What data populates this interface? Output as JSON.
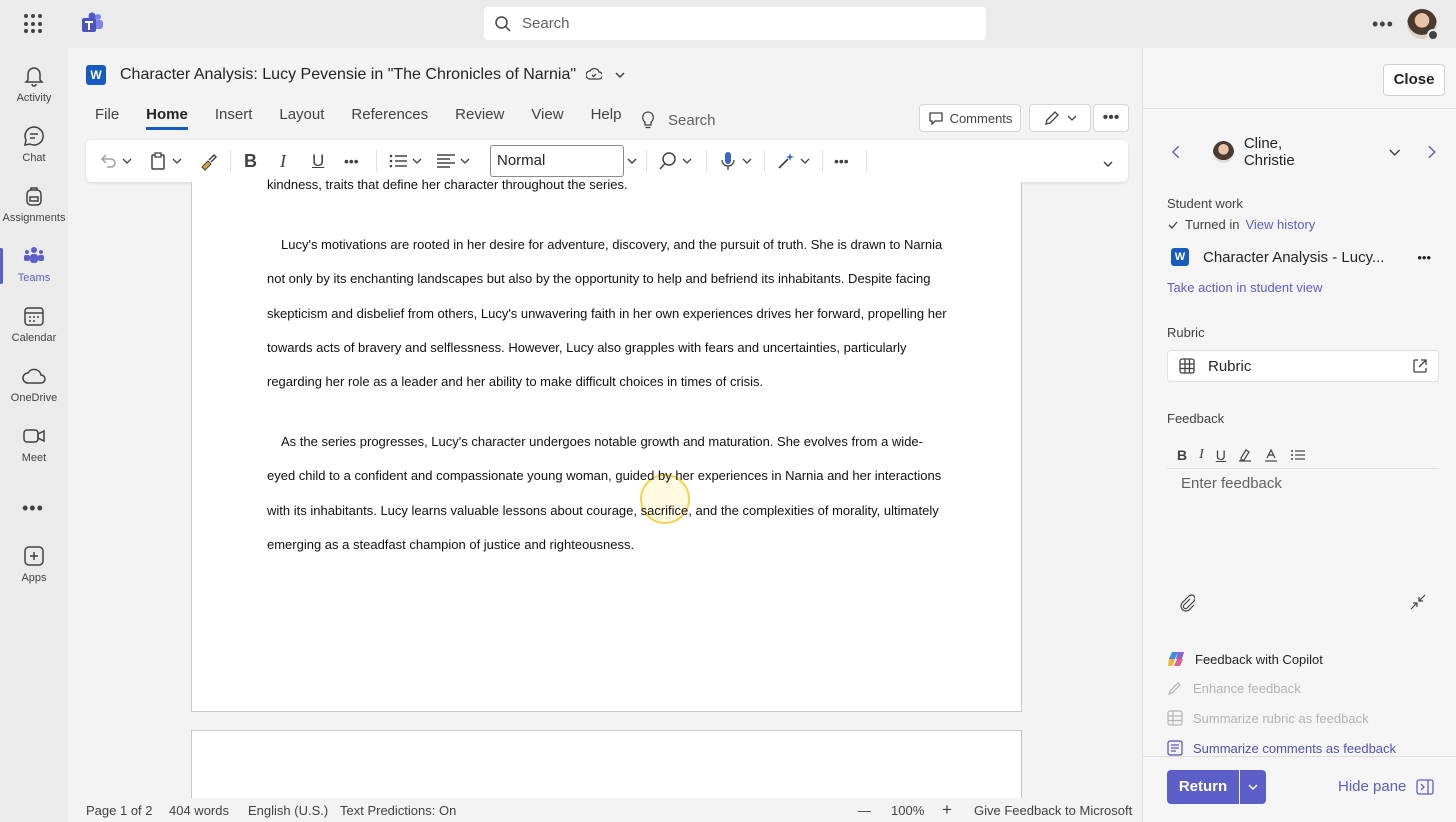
{
  "topbar": {
    "search_placeholder": "Search",
    "more_label": "•••"
  },
  "rail": {
    "items": [
      {
        "label": "Activity",
        "icon": "bell-icon"
      },
      {
        "label": "Chat",
        "icon": "chat-icon"
      },
      {
        "label": "Assignments",
        "icon": "backpack-icon"
      },
      {
        "label": "Teams",
        "icon": "teams-icon",
        "active": true
      },
      {
        "label": "Calendar",
        "icon": "calendar-icon"
      },
      {
        "label": "OneDrive",
        "icon": "cloud-icon"
      },
      {
        "label": "Meet",
        "icon": "video-icon"
      },
      {
        "label": "Apps",
        "icon": "plus-square-icon"
      }
    ],
    "more_label": "•••"
  },
  "document": {
    "title": "Character Analysis: Lucy Pevensie in \"The Chronicles of Narnia\"",
    "word_letter": "W",
    "menu": [
      "File",
      "Home",
      "Insert",
      "Layout",
      "References",
      "Review",
      "View",
      "Help"
    ],
    "menu_active": "Home",
    "menu_search": "Search",
    "comments_label": "Comments",
    "style_value": "Normal",
    "partial_line": "kindness, traits that define her character throughout the series.",
    "paragraphs": [
      "Lucy's motivations are rooted in her desire for adventure, discovery, and the pursuit of truth. She is drawn to Narnia not only by its enchanting landscapes but also by the opportunity to help and befriend its inhabitants. Despite facing skepticism and disbelief from others, Lucy's unwavering faith in her own experiences drives her forward, propelling her towards acts of bravery and selflessness. However, Lucy also grapples with fears and uncertainties, particularly regarding her role as a leader and her ability to make difficult choices in times of crisis.",
      "As the series progresses, Lucy's character undergoes notable growth and maturation. She evolves from a wide-eyed child to a confident and compassionate young woman, guided by her experiences in Narnia and her interactions with its inhabitants. Lucy learns valuable lessons about courage, sacrifice, and the complexities of morality, ultimately emerging as a steadfast champion of justice and righteousness."
    ]
  },
  "statusbar": {
    "page": "Page 1 of 2",
    "words": "404 words",
    "language": "English (U.S.)",
    "predictions": "Text Predictions: On",
    "minus": "—",
    "zoom": "100%",
    "plus": "+",
    "feedback": "Give Feedback to Microsoft"
  },
  "pane": {
    "close_label": "Close",
    "student_name": "Cline, Christie",
    "student_work_label": "Student work",
    "turned_in": "Turned in",
    "view_history": "View history",
    "file_name": "Character Analysis - Lucy...",
    "take_action": "Take action in student view",
    "rubric_label": "Rubric",
    "rubric_card": "Rubric",
    "feedback_label": "Feedback",
    "feedback_placeholder": "Enter feedback",
    "copilot_title": "Feedback with Copilot",
    "copilot_actions": [
      {
        "label": "Enhance feedback",
        "enabled": false
      },
      {
        "label": "Summarize rubric as feedback",
        "enabled": false
      },
      {
        "label": "Summarize comments as feedback",
        "enabled": true
      }
    ],
    "return_label": "Return",
    "hide_pane_label": "Hide pane"
  },
  "colors": {
    "accent": "#5b5fc7",
    "word_blue": "#185abd"
  }
}
